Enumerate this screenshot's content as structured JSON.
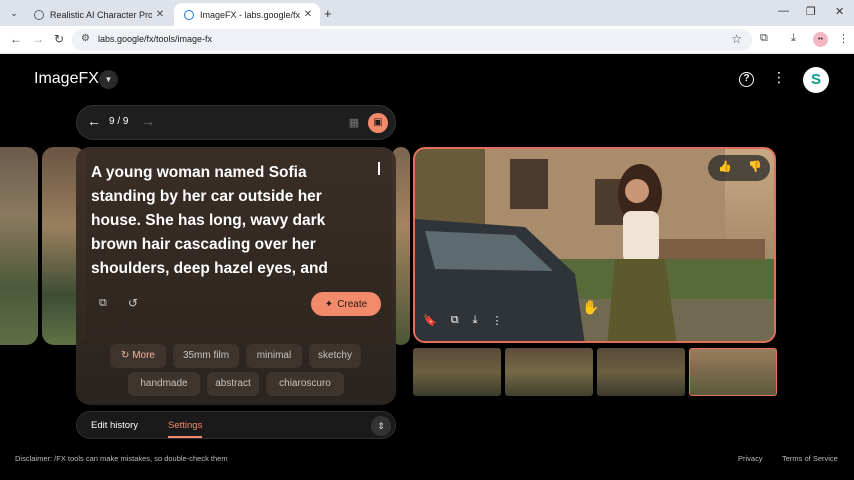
{
  "browser": {
    "tabs": [
      {
        "title": "Realistic AI Character Prompt",
        "active": false
      },
      {
        "title": "ImageFX - labs.google/fx",
        "active": true
      }
    ],
    "url": "labs.google/fx/tools/image-fx",
    "new_tab_glyph": "+",
    "window_controls": [
      "—",
      "❐",
      "✕"
    ]
  },
  "app": {
    "brand": "ImageFX",
    "nav": {
      "counter": "9 / 9"
    },
    "prompt": "A young woman named Sofia standing by her car outside her house. She has long, wavy dark brown hair cascading over her shoulders, deep hazel eyes, and",
    "create_label": "Create",
    "chips": [
      "More",
      "35mm film",
      "minimal",
      "sketchy",
      "handmade",
      "abstract",
      "chiaroscuro"
    ],
    "bottom_tabs": {
      "edit_history": "Edit history",
      "settings": "Settings"
    },
    "avatar_letter": "S",
    "disclaimer": "Disclaimer: /FX tools can make mistakes, so double-check them",
    "footer_links": {
      "privacy": "Privacy",
      "terms": "Terms of Service"
    },
    "thumbnails": {
      "count": 4,
      "selected": 4
    }
  },
  "colors": {
    "accent": "#f28a6c",
    "selection_border": "#e36f5a",
    "background": "#000000"
  },
  "icons": [
    "arrow-left-icon",
    "arrow-right-icon",
    "grid-view-icon",
    "single-view-icon",
    "copy-icon",
    "reset-icon",
    "sparkle-icon",
    "refresh-icon",
    "thumbs-up-icon",
    "thumbs-down-icon",
    "bookmark-icon",
    "duplicate-icon",
    "download-icon",
    "more-vert-icon",
    "help-icon",
    "chevron-expand-icon"
  ]
}
